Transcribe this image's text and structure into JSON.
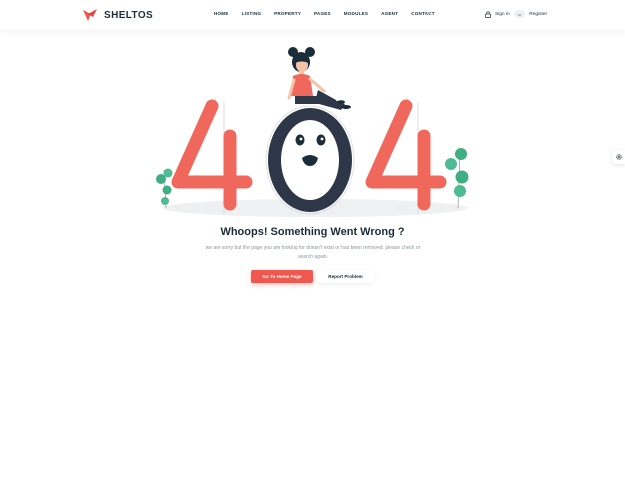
{
  "brand": {
    "name": "SHELTOS",
    "accent_color": "#f0584f"
  },
  "nav": {
    "items": [
      "HOME",
      "LISTING",
      "PROPERTY",
      "PAGES",
      "MODULES",
      "AGENT",
      "CONTACT"
    ]
  },
  "account": {
    "signin_label": "Sign in",
    "or_label": "or",
    "register_label": "Register",
    "icon": "lock-icon"
  },
  "settings": {
    "icon": "gear-icon"
  },
  "error": {
    "code": "404",
    "title": "Whoops! Something Went Wrong ?",
    "description": "we are sorry but the page you are looking for doesn't exist or has been removed. please check or search again.",
    "primary_button": "Go To Home Page",
    "secondary_button": "Report Problem"
  },
  "colors": {
    "dark": "#1c2d3a",
    "leaf": "#3fae85",
    "muted": "#8a959c"
  }
}
